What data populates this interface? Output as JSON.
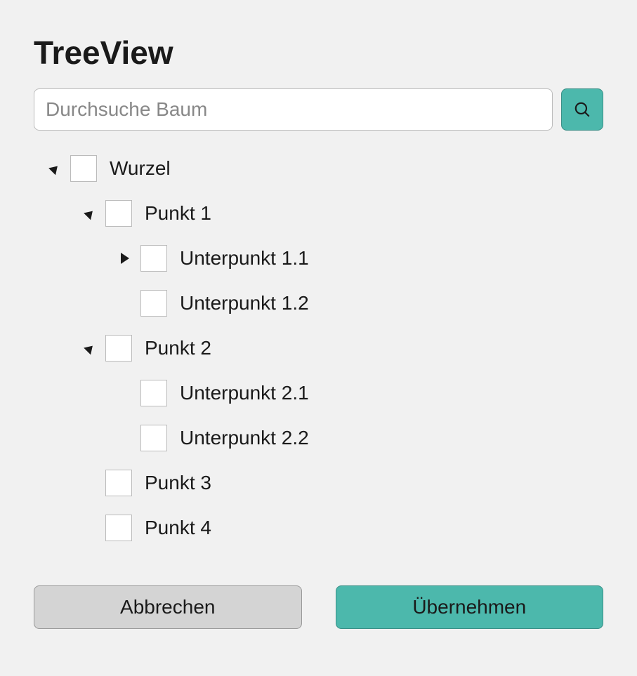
{
  "title": "TreeView",
  "search": {
    "placeholder": "Durchsuche Baum"
  },
  "tree": {
    "root": {
      "label": "Wurzel",
      "expanded": true
    },
    "p1": {
      "label": "Punkt 1",
      "expanded": true
    },
    "p1_1": {
      "label": "Unterpunkt 1.1",
      "expanded": false
    },
    "p1_2": {
      "label": "Unterpunkt 1.2"
    },
    "p2": {
      "label": "Punkt 2",
      "expanded": true
    },
    "p2_1": {
      "label": "Unterpunkt 2.1"
    },
    "p2_2": {
      "label": "Unterpunkt 2.2"
    },
    "p3": {
      "label": "Punkt 3"
    },
    "p4": {
      "label": "Punkt 4"
    }
  },
  "actions": {
    "cancel": "Abbrechen",
    "apply": "Übernehmen"
  },
  "colors": {
    "accent": "#4cb8ac"
  }
}
